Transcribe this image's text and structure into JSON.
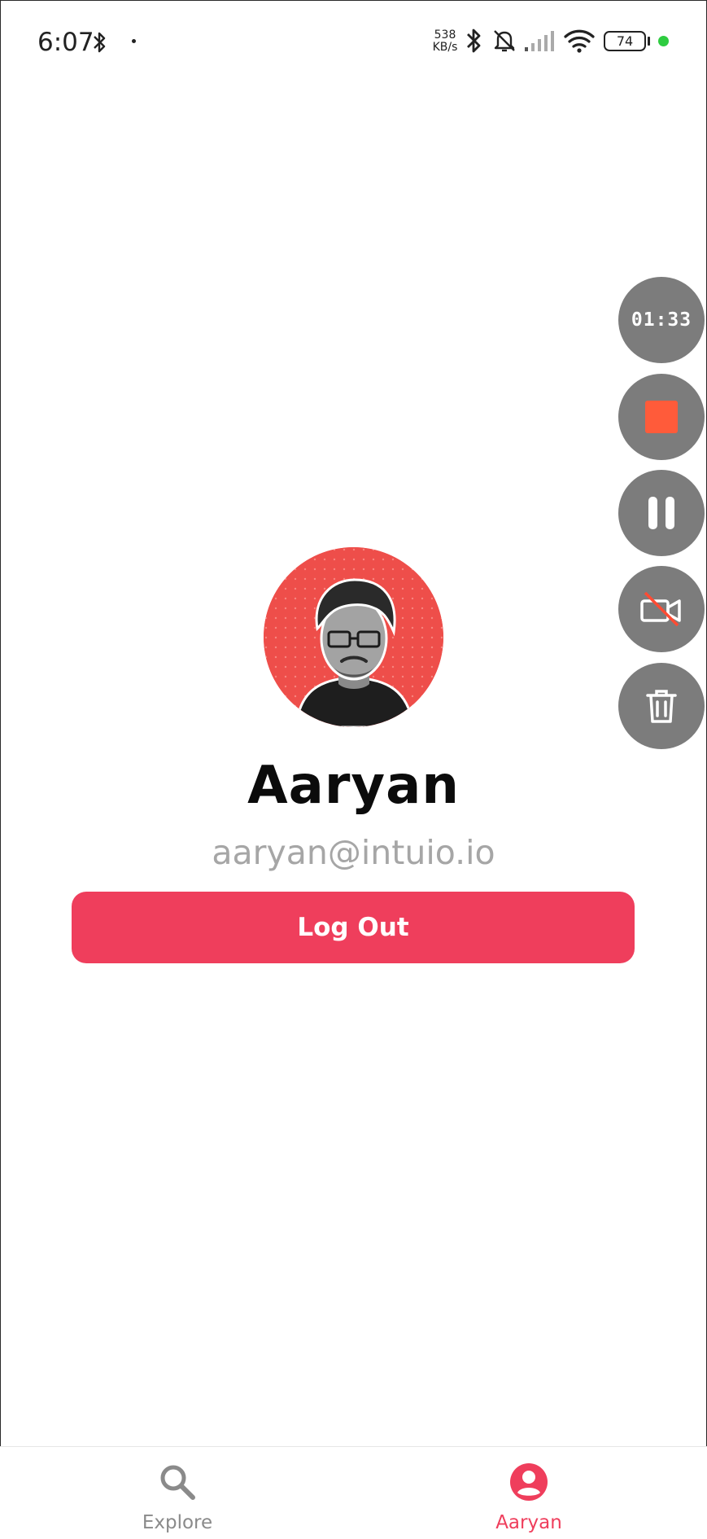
{
  "status_bar": {
    "time": "6:07",
    "net_speed_value": "538",
    "net_speed_unit": "KB/s",
    "battery": "74",
    "icons": [
      "bluetooth-icon",
      "dot-icon",
      "bluetooth-icon",
      "bell-off-icon",
      "signal-icon",
      "wifi-icon",
      "battery-icon",
      "green-dot-indicator"
    ]
  },
  "recorder": {
    "timer": "01:33",
    "buttons": [
      "stop-icon",
      "pause-icon",
      "camera-off-icon",
      "trash-icon"
    ],
    "stop_color": "#ff5b3a"
  },
  "profile": {
    "name": "Aaryan",
    "email": "aaryan@intuio.io",
    "avatar_bg": "#ee4e4a"
  },
  "actions": {
    "logout_label": "Log Out",
    "accent": "#ef3e5c"
  },
  "bottom_nav": {
    "items": [
      {
        "label": "Explore",
        "icon": "search-icon",
        "active": false
      },
      {
        "label": "Aaryan",
        "icon": "user-circle-icon",
        "active": true
      }
    ],
    "active_color": "#ef3e5c",
    "inactive_color": "#8a8a8a"
  }
}
